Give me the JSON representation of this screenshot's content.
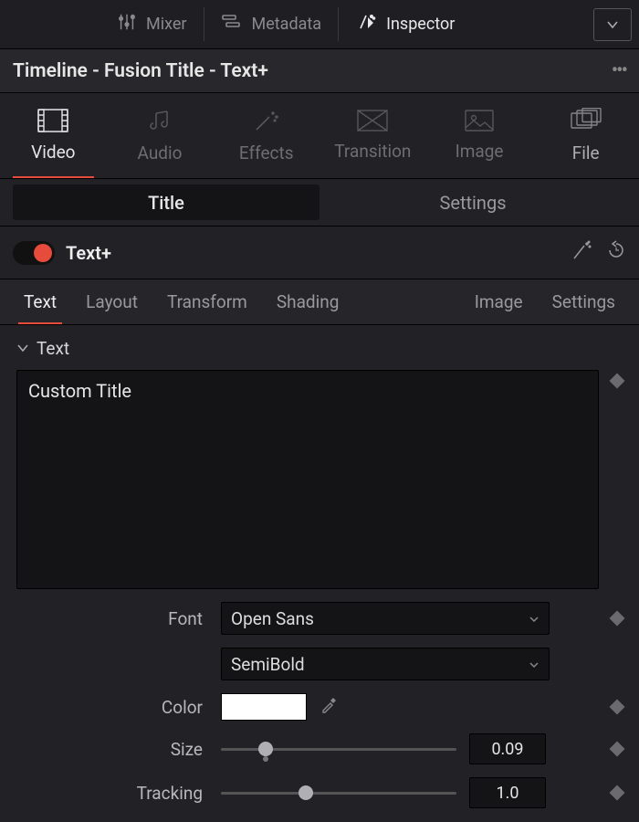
{
  "topbar": {
    "items": [
      {
        "label": "Mixer",
        "icon": "mixer"
      },
      {
        "label": "Metadata",
        "icon": "metadata"
      },
      {
        "label": "Inspector",
        "icon": "inspector"
      }
    ],
    "active_index": 2
  },
  "titlebar": {
    "title": "Timeline - Fusion Title - Text+"
  },
  "categories": {
    "items": [
      {
        "label": "Video"
      },
      {
        "label": "Audio"
      },
      {
        "label": "Effects"
      },
      {
        "label": "Transition"
      },
      {
        "label": "Image"
      },
      {
        "label": "File"
      }
    ],
    "active_index": 0
  },
  "segtabs": {
    "items": [
      {
        "label": "Title"
      },
      {
        "label": "Settings"
      }
    ],
    "active_index": 0
  },
  "effect": {
    "enabled": true,
    "name": "Text+"
  },
  "subtabs": {
    "left": [
      {
        "label": "Text"
      },
      {
        "label": "Layout"
      },
      {
        "label": "Transform"
      },
      {
        "label": "Shading"
      }
    ],
    "right": [
      {
        "label": "Image"
      },
      {
        "label": "Settings"
      }
    ],
    "active": "Text"
  },
  "section": {
    "name": "Text",
    "expanded": true
  },
  "fields": {
    "text_value": "Custom Title",
    "font_label": "Font",
    "font_family": "Open Sans",
    "font_weight": "SemiBold",
    "color_label": "Color",
    "color_value": "#FFFFFF",
    "size_label": "Size",
    "size_value": "0.09",
    "size_fraction": 0.16,
    "tracking_label": "Tracking",
    "tracking_value": "1.0",
    "tracking_fraction": 0.33
  }
}
